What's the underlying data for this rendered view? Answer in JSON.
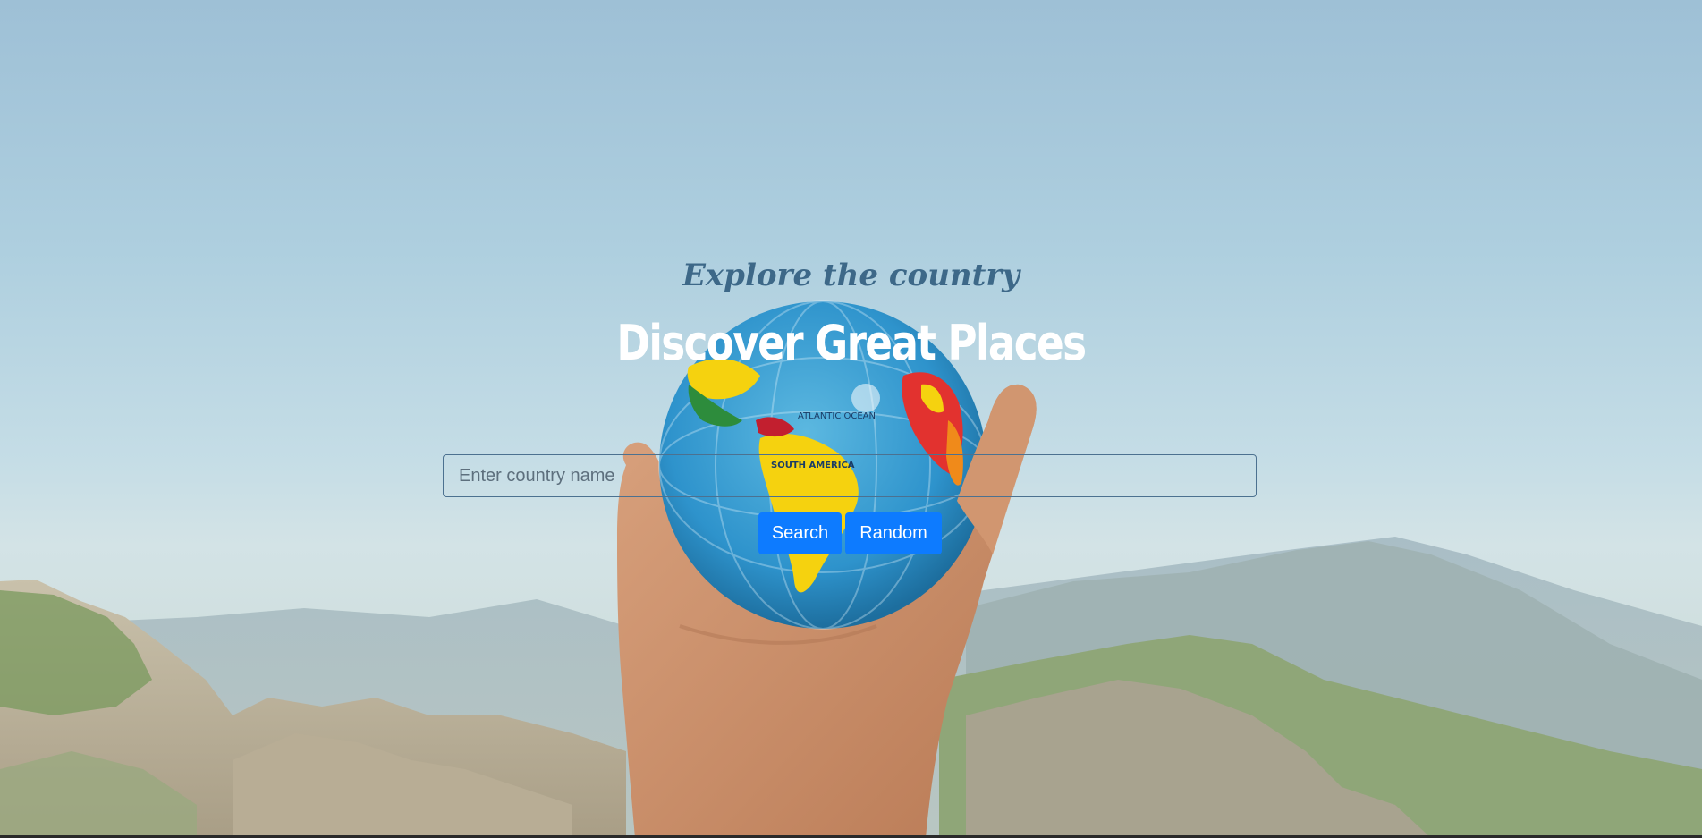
{
  "hero": {
    "subtitle": "Explore the country",
    "title": "Discover Great Places",
    "globe_label_ocean": "ATLANTIC OCEAN",
    "globe_label_continent": "SOUTH AMERICA"
  },
  "search": {
    "placeholder": "Enter country name",
    "value": ""
  },
  "actions": {
    "search_label": "Search",
    "random_label": "Random"
  },
  "colors": {
    "accent": "#0d7bff",
    "subtitle": "#3d6888",
    "title": "#ffffff"
  }
}
